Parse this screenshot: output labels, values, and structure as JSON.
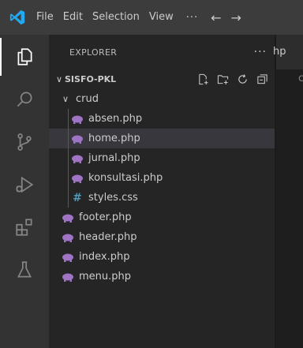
{
  "titlebar": {
    "menu": [
      "File",
      "Edit",
      "Selection",
      "View"
    ],
    "more": "···",
    "back": "←",
    "forward": "→"
  },
  "activitybar": {
    "icons": [
      "explorer-icon",
      "search-icon",
      "source-control-icon",
      "run-debug-icon",
      "extensions-icon",
      "testing-icon"
    ]
  },
  "explorer": {
    "title": "EXPLORER",
    "more": "···",
    "project": {
      "name": "SISFO-PKL",
      "chevron": "∨"
    },
    "folder": {
      "name": "crud",
      "chevron": "∨"
    },
    "crud_files": [
      {
        "name": "absen.php",
        "icon": "php-elephant-icon"
      },
      {
        "name": "home.php",
        "icon": "php-elephant-icon",
        "selected": true
      },
      {
        "name": "jurnal.php",
        "icon": "php-elephant-icon"
      },
      {
        "name": "konsultasi.php",
        "icon": "php-elephant-icon"
      },
      {
        "name": "styles.css",
        "icon": "css-hash-icon",
        "glyph": "#"
      }
    ],
    "root_files": [
      {
        "name": "footer.php",
        "icon": "php-elephant-icon"
      },
      {
        "name": "header.php",
        "icon": "php-elephant-icon"
      },
      {
        "name": "index.php",
        "icon": "php-elephant-icon"
      },
      {
        "name": "menu.php",
        "icon": "php-elephant-icon"
      }
    ]
  },
  "editor": {
    "tab_label": "hp",
    "line_fragment": "c"
  },
  "colors": {
    "logo": "#23a9f2",
    "php": "#a074c4",
    "css": "#519aba",
    "selected_row": "#37373d"
  }
}
